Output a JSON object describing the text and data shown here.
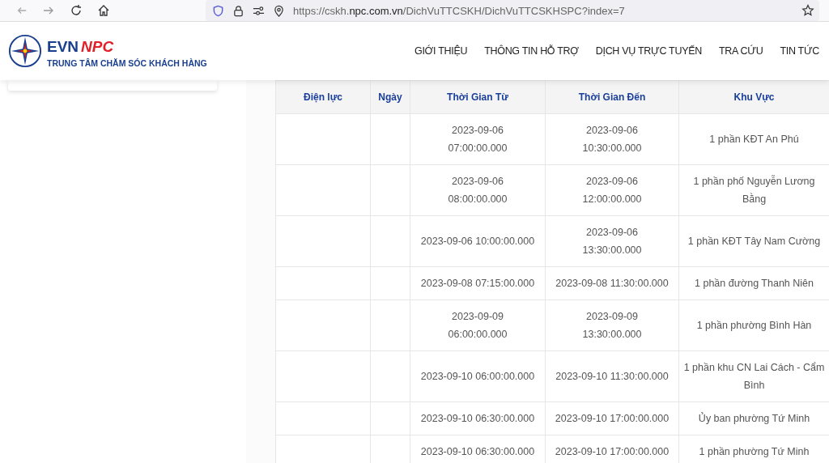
{
  "browser": {
    "url_prefix": "https://cskh.",
    "url_domain": "npc.com.vn",
    "url_path": "/DichVuTTCSKH/DichVuTTCSKHSPC?index=7"
  },
  "brand": {
    "name_a": "EVN",
    "name_b": "NPC",
    "tagline": "TRUNG TÂM CHĂM SÓC KHÁCH HÀNG"
  },
  "nav": [
    "GIỚI THIỆU",
    "THÔNG TIN HỖ TRỢ",
    "DỊCH VỤ TRỰC TUYẾN",
    "TRA CỨU",
    "TIN TỨC"
  ],
  "table": {
    "columns": [
      "Điện lực",
      "Ngày",
      "Thời Gian Từ",
      "Thời Gian Đến",
      "Khu Vực"
    ],
    "rows": [
      {
        "from": [
          "2023-09-06",
          "07:00:00.000"
        ],
        "to": [
          "2023-09-06",
          "10:30:00.000"
        ],
        "area": "1 phần KĐT An Phú"
      },
      {
        "from": [
          "2023-09-06",
          "08:00:00.000"
        ],
        "to": [
          "2023-09-06",
          "12:00:00.000"
        ],
        "area": "1 phần phố Nguyễn Lương Bằng"
      },
      {
        "from": [
          "2023-09-06 10:00:00.000"
        ],
        "to": [
          "2023-09-06",
          "13:30:00.000"
        ],
        "area": "1 phần KĐT Tây Nam Cường"
      },
      {
        "from": [
          "2023-09-08 07:15:00.000"
        ],
        "to": [
          "2023-09-08 11:30:00.000"
        ],
        "area": "1 phần đường Thanh Niên"
      },
      {
        "from": [
          "2023-09-09",
          "06:00:00.000"
        ],
        "to": [
          "2023-09-09",
          "13:30:00.000"
        ],
        "area": "1 phần phường Bình Hàn"
      },
      {
        "from": [
          "2023-09-10 06:00:00.000"
        ],
        "to": [
          "2023-09-10 11:30:00.000"
        ],
        "area": "1 phần khu CN Lai Cách - Cẩm Bình"
      },
      {
        "from": [
          "2023-09-10 06:30:00.000"
        ],
        "to": [
          "2023-09-10 17:00:00.000"
        ],
        "area": "Ủy ban phường Tứ Minh"
      },
      {
        "from": [
          "2023-09-10 06:30:00.000"
        ],
        "to": [
          "2023-09-10 17:00:00.000"
        ],
        "area": "1 phần phường Tứ Minh"
      }
    ]
  }
}
